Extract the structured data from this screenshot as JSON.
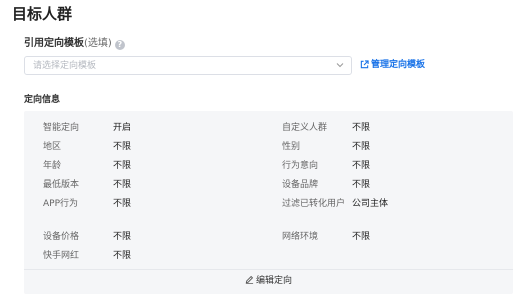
{
  "page": {
    "title": "目标人群"
  },
  "template": {
    "label": "引用定向模板",
    "optional": "(选填)",
    "help_icon": "question-circle-icon",
    "placeholder": "请选择定向模板",
    "manage_link": "管理定向模板"
  },
  "targeting": {
    "section_title": "定向信息",
    "left": [
      {
        "label": "智能定向",
        "value": "开启"
      },
      {
        "label": "地区",
        "value": "不限"
      },
      {
        "label": "年龄",
        "value": "不限"
      },
      {
        "label": "最低版本",
        "value": "不限"
      },
      {
        "label": "APP行为",
        "value": "不限"
      },
      {
        "label": "设备价格",
        "value": "不限"
      },
      {
        "label": "快手网红",
        "value": "不限"
      }
    ],
    "right": [
      {
        "label": "自定义人群",
        "value": "不限"
      },
      {
        "label": "性别",
        "value": "不限"
      },
      {
        "label": "行为意向",
        "value": "不限"
      },
      {
        "label": "设备品牌",
        "value": "不限"
      },
      {
        "label": "过滤已转化用户",
        "value": "公司主体"
      },
      {
        "label": "网络环境",
        "value": "不限"
      }
    ],
    "edit_label": "编辑定向"
  },
  "colors": {
    "accent": "#1a73e8",
    "panel_bg": "#f5f6f8"
  }
}
